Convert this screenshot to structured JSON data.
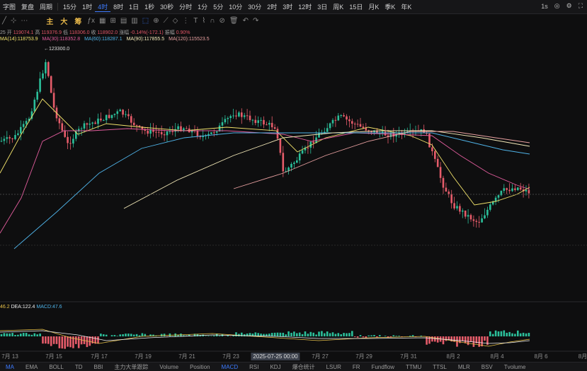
{
  "topbar": {
    "left_items": [
      "字图",
      "复盘",
      "周期"
    ],
    "timeframes": [
      "15分",
      "1时",
      "4时",
      "8时",
      "1日",
      "1秒",
      "30秒",
      "分时",
      "1分",
      "5分",
      "10分",
      "30分",
      "2时",
      "3时",
      "12时",
      "3日",
      "周K",
      "15日",
      "月K",
      "季K",
      "年K"
    ],
    "active_timeframe": "4时",
    "right": {
      "interval": "1s"
    }
  },
  "toolbar": {
    "indicators": [
      "主",
      "大",
      "筹"
    ],
    "indicator_colors": [
      "#e8b84a",
      "#e8b84a",
      "#e8b84a"
    ]
  },
  "ohlc": {
    "open_label": "开",
    "open": "119074.1",
    "high_label": "高",
    "high": "119376.9",
    "low_label": "低",
    "low": "118306.0",
    "close_label": "收",
    "close": "118902.0",
    "change_label": "涨幅",
    "change": "-0.14%(-172.1)",
    "amp_label": "振幅",
    "amp": "0.90%",
    "date_prefix": "25"
  },
  "ma": [
    {
      "label": "MA(14):118753.9",
      "color": "#f2e36b"
    },
    {
      "label": "MA(30):118352.8",
      "color": "#e05c9c"
    },
    {
      "label": "MA(60):118287.1",
      "color": "#4fb3e8"
    },
    {
      "label": "MA(90):117855.5",
      "color": "#f3e9b8"
    },
    {
      "label": "MA(120):115523.5",
      "color": "#e8a0a0"
    }
  ],
  "peak_label": "123300.0",
  "macd": {
    "dif": "46.2",
    "dea": "DEA:122.4",
    "macd": "MACD:47.6",
    "colors": {
      "dif": "#e8c24a",
      "dea": "#f0f0f0",
      "macd": "#4fb3e8"
    }
  },
  "xaxis": {
    "labels": [
      "7月 13",
      "7月 15",
      "7月 17",
      "7月 19",
      "7月 21",
      "7月 23",
      "2025-07-25 00:00",
      "7月 27",
      "7月 29",
      "7月 31",
      "8月 2",
      "8月 4",
      "8月 6",
      "8月"
    ],
    "highlight": "2025-07-25 00:00"
  },
  "bottombar": {
    "tabs": [
      "MA",
      "EMA",
      "BOLL",
      "TD",
      "BBI",
      "主力大单跟踪",
      "Volume",
      "Position",
      "MACD",
      "RSI",
      "KDJ",
      "爆仓统计",
      "LSUR",
      "FR",
      "Fundflow",
      "TTMU",
      "TTSL",
      "MLR",
      "BSV",
      "Tvolume"
    ],
    "active_main": "MA",
    "active_sub": "MACD"
  },
  "colors": {
    "up": "#2bbf9a",
    "down": "#e65c6a",
    "bg": "#0e0e0f"
  }
}
